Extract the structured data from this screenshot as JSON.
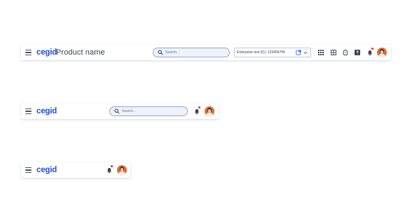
{
  "brand": {
    "logo": "cegid",
    "product_name": "Product name"
  },
  "search": {
    "placeholder": "Search..."
  },
  "context": {
    "label": "Enterprise test (0) | 123456789"
  },
  "icons": {
    "menu": "menu-icon",
    "search": "search-icon",
    "external_link": "external-link-icon",
    "chevron": "chevron-down-icon",
    "apps": "apps-grid-icon",
    "grid": "grid-icon",
    "lightbulb": "lightbulb-icon",
    "help": "help-icon",
    "notifications": "bell-icon"
  },
  "colors": {
    "brand": "#1e4fd6",
    "badge": "#e02a2a",
    "avatar": "#e36a3a",
    "search_border": "#8fa6cc"
  }
}
